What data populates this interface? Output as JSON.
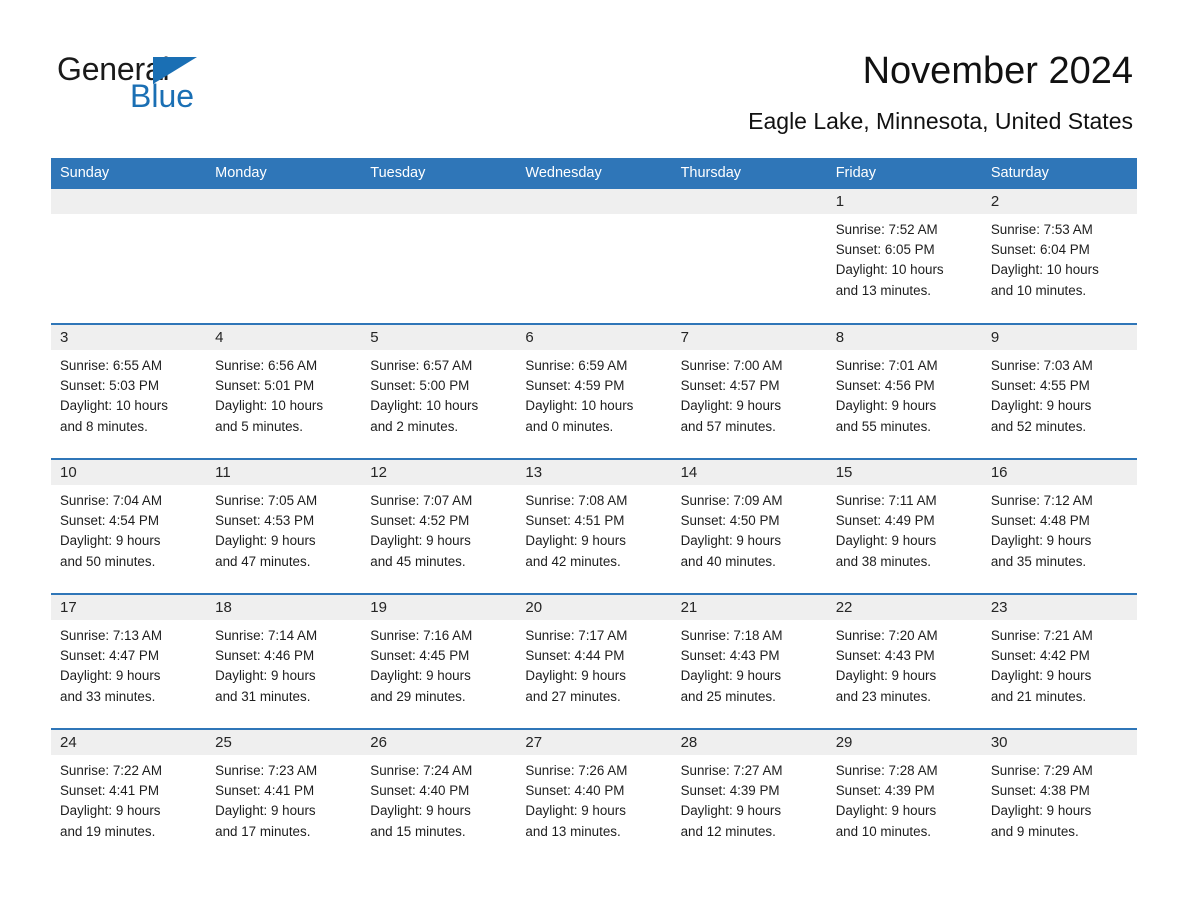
{
  "brand": {
    "name_part1": "General",
    "name_part2": "Blue",
    "triangle_icon": "triangle-icon",
    "accent_color": "#1a6fb4"
  },
  "header": {
    "title": "November 2024",
    "location": "Eagle Lake, Minnesota, United States"
  },
  "theme": {
    "header_row_bg": "#2f76b8",
    "header_row_text": "#ffffff",
    "daynum_band_bg": "#efefef",
    "row_rule_color": "#2f76b8",
    "cell_bg": "#ffffff",
    "body_text": "#1d1d1d"
  },
  "calendar": {
    "columns": [
      "Sunday",
      "Monday",
      "Tuesday",
      "Wednesday",
      "Thursday",
      "Friday",
      "Saturday"
    ],
    "weeks": [
      [
        {
          "day": "",
          "lines": []
        },
        {
          "day": "",
          "lines": []
        },
        {
          "day": "",
          "lines": []
        },
        {
          "day": "",
          "lines": []
        },
        {
          "day": "",
          "lines": []
        },
        {
          "day": "1",
          "lines": [
            "Sunrise: 7:52 AM",
            "Sunset: 6:05 PM",
            "Daylight: 10 hours",
            "and 13 minutes."
          ]
        },
        {
          "day": "2",
          "lines": [
            "Sunrise: 7:53 AM",
            "Sunset: 6:04 PM",
            "Daylight: 10 hours",
            "and 10 minutes."
          ]
        }
      ],
      [
        {
          "day": "3",
          "lines": [
            "Sunrise: 6:55 AM",
            "Sunset: 5:03 PM",
            "Daylight: 10 hours",
            "and 8 minutes."
          ]
        },
        {
          "day": "4",
          "lines": [
            "Sunrise: 6:56 AM",
            "Sunset: 5:01 PM",
            "Daylight: 10 hours",
            "and 5 minutes."
          ]
        },
        {
          "day": "5",
          "lines": [
            "Sunrise: 6:57 AM",
            "Sunset: 5:00 PM",
            "Daylight: 10 hours",
            "and 2 minutes."
          ]
        },
        {
          "day": "6",
          "lines": [
            "Sunrise: 6:59 AM",
            "Sunset: 4:59 PM",
            "Daylight: 10 hours",
            "and 0 minutes."
          ]
        },
        {
          "day": "7",
          "lines": [
            "Sunrise: 7:00 AM",
            "Sunset: 4:57 PM",
            "Daylight: 9 hours",
            "and 57 minutes."
          ]
        },
        {
          "day": "8",
          "lines": [
            "Sunrise: 7:01 AM",
            "Sunset: 4:56 PM",
            "Daylight: 9 hours",
            "and 55 minutes."
          ]
        },
        {
          "day": "9",
          "lines": [
            "Sunrise: 7:03 AM",
            "Sunset: 4:55 PM",
            "Daylight: 9 hours",
            "and 52 minutes."
          ]
        }
      ],
      [
        {
          "day": "10",
          "lines": [
            "Sunrise: 7:04 AM",
            "Sunset: 4:54 PM",
            "Daylight: 9 hours",
            "and 50 minutes."
          ]
        },
        {
          "day": "11",
          "lines": [
            "Sunrise: 7:05 AM",
            "Sunset: 4:53 PM",
            "Daylight: 9 hours",
            "and 47 minutes."
          ]
        },
        {
          "day": "12",
          "lines": [
            "Sunrise: 7:07 AM",
            "Sunset: 4:52 PM",
            "Daylight: 9 hours",
            "and 45 minutes."
          ]
        },
        {
          "day": "13",
          "lines": [
            "Sunrise: 7:08 AM",
            "Sunset: 4:51 PM",
            "Daylight: 9 hours",
            "and 42 minutes."
          ]
        },
        {
          "day": "14",
          "lines": [
            "Sunrise: 7:09 AM",
            "Sunset: 4:50 PM",
            "Daylight: 9 hours",
            "and 40 minutes."
          ]
        },
        {
          "day": "15",
          "lines": [
            "Sunrise: 7:11 AM",
            "Sunset: 4:49 PM",
            "Daylight: 9 hours",
            "and 38 minutes."
          ]
        },
        {
          "day": "16",
          "lines": [
            "Sunrise: 7:12 AM",
            "Sunset: 4:48 PM",
            "Daylight: 9 hours",
            "and 35 minutes."
          ]
        }
      ],
      [
        {
          "day": "17",
          "lines": [
            "Sunrise: 7:13 AM",
            "Sunset: 4:47 PM",
            "Daylight: 9 hours",
            "and 33 minutes."
          ]
        },
        {
          "day": "18",
          "lines": [
            "Sunrise: 7:14 AM",
            "Sunset: 4:46 PM",
            "Daylight: 9 hours",
            "and 31 minutes."
          ]
        },
        {
          "day": "19",
          "lines": [
            "Sunrise: 7:16 AM",
            "Sunset: 4:45 PM",
            "Daylight: 9 hours",
            "and 29 minutes."
          ]
        },
        {
          "day": "20",
          "lines": [
            "Sunrise: 7:17 AM",
            "Sunset: 4:44 PM",
            "Daylight: 9 hours",
            "and 27 minutes."
          ]
        },
        {
          "day": "21",
          "lines": [
            "Sunrise: 7:18 AM",
            "Sunset: 4:43 PM",
            "Daylight: 9 hours",
            "and 25 minutes."
          ]
        },
        {
          "day": "22",
          "lines": [
            "Sunrise: 7:20 AM",
            "Sunset: 4:43 PM",
            "Daylight: 9 hours",
            "and 23 minutes."
          ]
        },
        {
          "day": "23",
          "lines": [
            "Sunrise: 7:21 AM",
            "Sunset: 4:42 PM",
            "Daylight: 9 hours",
            "and 21 minutes."
          ]
        }
      ],
      [
        {
          "day": "24",
          "lines": [
            "Sunrise: 7:22 AM",
            "Sunset: 4:41 PM",
            "Daylight: 9 hours",
            "and 19 minutes."
          ]
        },
        {
          "day": "25",
          "lines": [
            "Sunrise: 7:23 AM",
            "Sunset: 4:41 PM",
            "Daylight: 9 hours",
            "and 17 minutes."
          ]
        },
        {
          "day": "26",
          "lines": [
            "Sunrise: 7:24 AM",
            "Sunset: 4:40 PM",
            "Daylight: 9 hours",
            "and 15 minutes."
          ]
        },
        {
          "day": "27",
          "lines": [
            "Sunrise: 7:26 AM",
            "Sunset: 4:40 PM",
            "Daylight: 9 hours",
            "and 13 minutes."
          ]
        },
        {
          "day": "28",
          "lines": [
            "Sunrise: 7:27 AM",
            "Sunset: 4:39 PM",
            "Daylight: 9 hours",
            "and 12 minutes."
          ]
        },
        {
          "day": "29",
          "lines": [
            "Sunrise: 7:28 AM",
            "Sunset: 4:39 PM",
            "Daylight: 9 hours",
            "and 10 minutes."
          ]
        },
        {
          "day": "30",
          "lines": [
            "Sunrise: 7:29 AM",
            "Sunset: 4:38 PM",
            "Daylight: 9 hours",
            "and 9 minutes."
          ]
        }
      ]
    ]
  }
}
